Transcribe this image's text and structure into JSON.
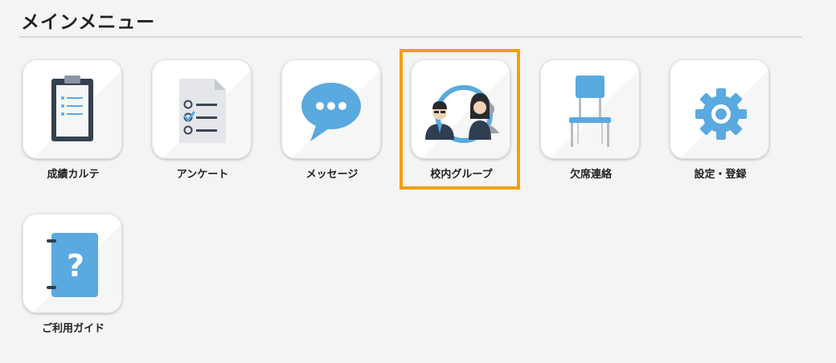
{
  "header": {
    "title": "メインメニュー"
  },
  "menu": {
    "items": [
      {
        "label": "成績カルテ",
        "icon": "clipboard-icon"
      },
      {
        "label": "アンケート",
        "icon": "survey-checklist-icon"
      },
      {
        "label": "メッセージ",
        "icon": "speech-bubble-icon"
      },
      {
        "label": "校内グループ",
        "icon": "group-people-icon",
        "selected": true
      },
      {
        "label": "欠席連絡",
        "icon": "chair-icon"
      },
      {
        "label": "設定・登録",
        "icon": "gear-icon"
      },
      {
        "label": "ご利用ガイド",
        "icon": "help-guide-icon"
      }
    ]
  },
  "colors": {
    "highlight": "#f0a010",
    "icon_blue": "#5aa9df",
    "icon_dark": "#2f3e52",
    "background": "#f4f4f4"
  }
}
